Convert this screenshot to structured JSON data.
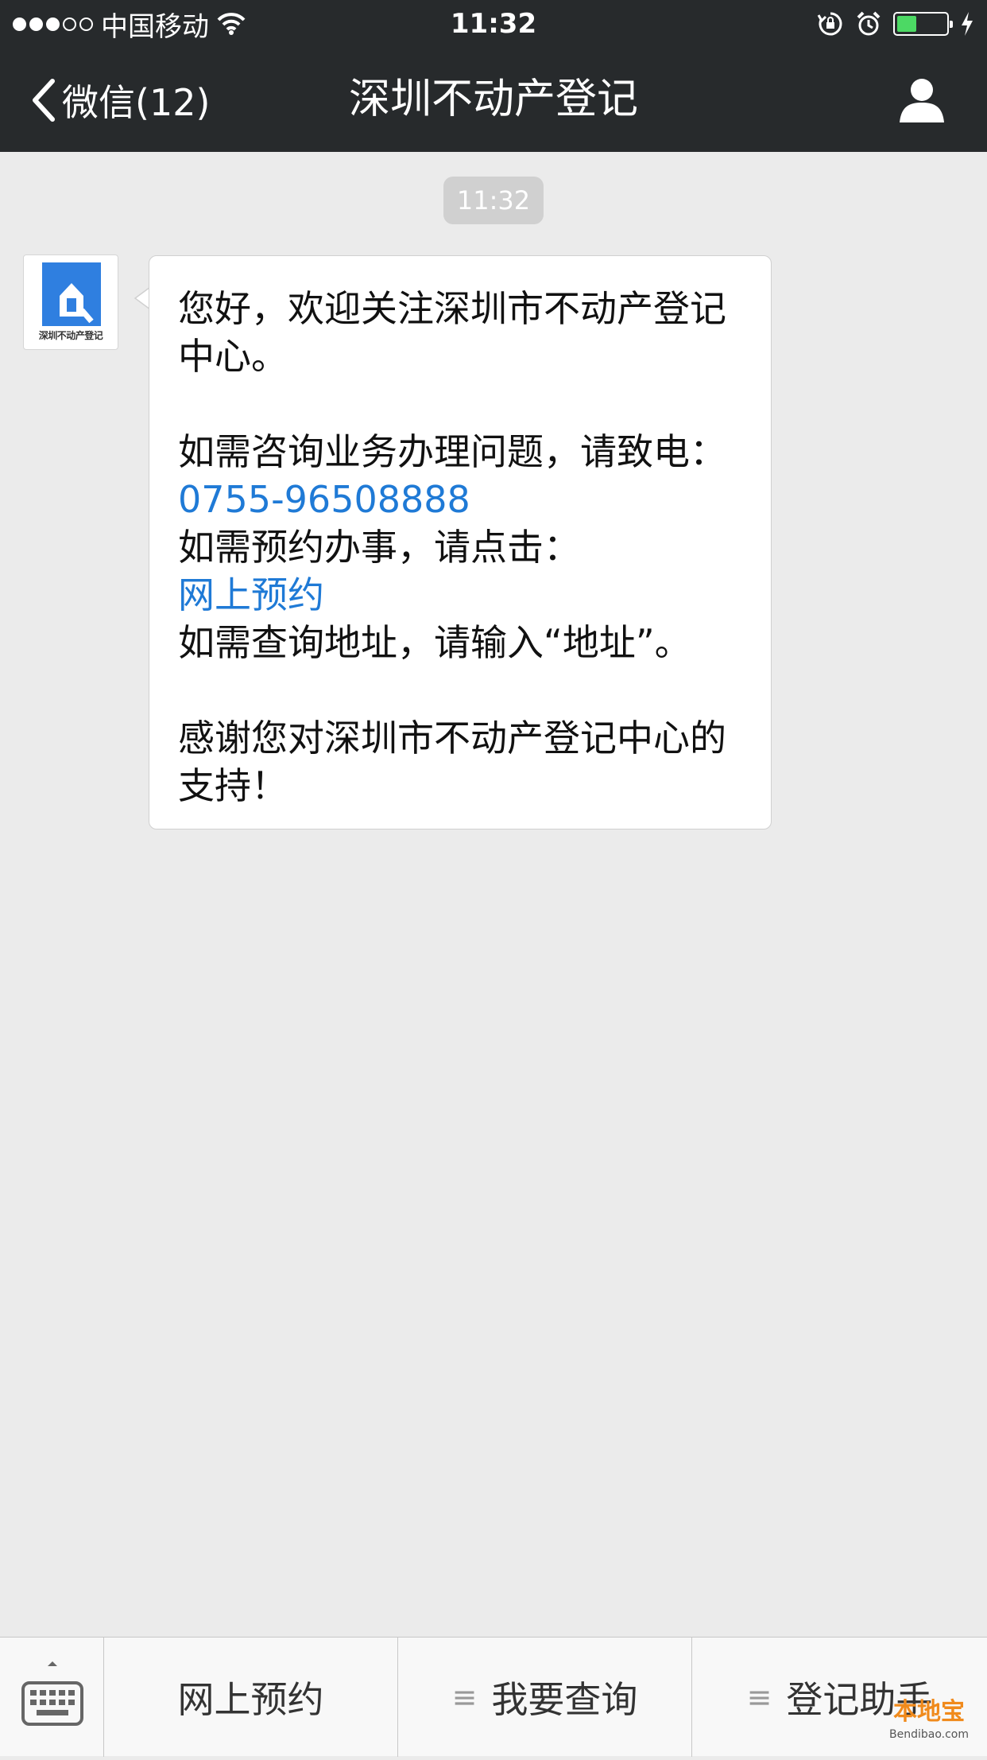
{
  "status_bar": {
    "carrier": "中国移动",
    "time": "11:32"
  },
  "nav": {
    "back_label": "微信(12)",
    "title": "深圳不动产登记"
  },
  "chat": {
    "timestamp": "11:32",
    "message_lines": [
      "您好，欢迎关注深圳市不动产登记",
      "中心。",
      "",
      "如需咨询业务办理问题，请致电：",
      "0755-96508888",
      "如需预约办事，请点击：",
      "网上预约",
      "如需查询地址，请输入“地址”。",
      "",
      "感谢您对深圳市不动产登记中心的",
      "支持！"
    ],
    "phone_link": "0755-96508888",
    "booking_link": "网上预约"
  },
  "bottom_menu": {
    "items": [
      {
        "label": "网上预约",
        "has_submenu": false
      },
      {
        "label": "我要查询",
        "has_submenu": true
      },
      {
        "label": "登记助手",
        "has_submenu": true
      }
    ]
  },
  "watermark": {
    "title": "本地宝",
    "url": "Bendibao.com"
  },
  "colors": {
    "nav_background": "#272a2c",
    "chat_background": "#ebebeb",
    "link": "#1f7ad6",
    "logo_blue": "#2f7fe0",
    "battery": "#4cd964"
  }
}
